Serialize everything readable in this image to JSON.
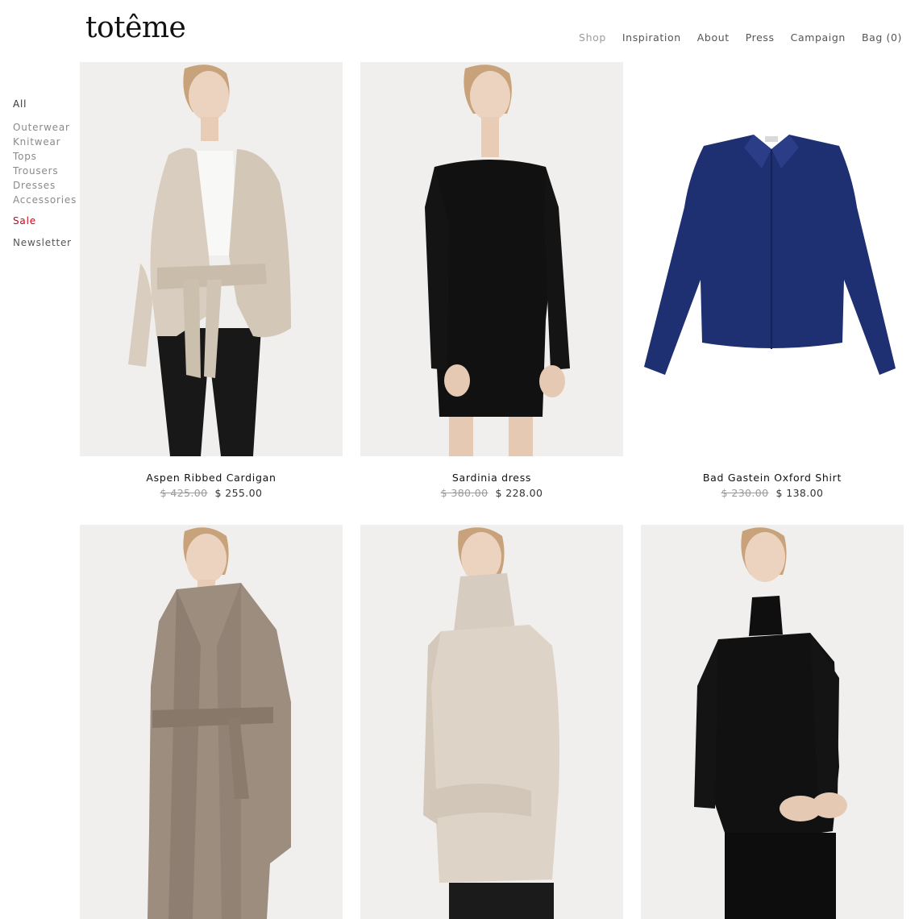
{
  "brand": {
    "logo_text": "totême"
  },
  "nav": {
    "items": [
      {
        "label": "Shop",
        "active": true
      },
      {
        "label": "Inspiration"
      },
      {
        "label": "About"
      },
      {
        "label": "Press"
      },
      {
        "label": "Campaign"
      },
      {
        "label": "Bag (0)"
      }
    ]
  },
  "sidebar": {
    "all": "All",
    "categories": [
      "Outerwear",
      "Knitwear",
      "Tops",
      "Trousers",
      "Dresses",
      "Accessories"
    ],
    "sale": "Sale",
    "newsletter": "Newsletter",
    "sale_color": "#d0021b"
  },
  "products": [
    {
      "name": "Aspen Ribbed Cardigan",
      "old_price": "$ 425.00",
      "price": "$ 255.00",
      "image": "model-beige-wrap-cardigan"
    },
    {
      "name": "Sardinia dress",
      "old_price": "$ 380.00",
      "price": "$ 228.00",
      "image": "model-black-dress"
    },
    {
      "name": "Bad Gastein Oxford Shirt",
      "old_price": "$ 230.00",
      "price": "$ 138.00",
      "image": "navy-shirt-flatlay"
    },
    {
      "image": "model-taupe-belted-coat"
    },
    {
      "image": "model-beige-turtleneck-sweater"
    },
    {
      "image": "model-black-turtleneck"
    }
  ]
}
